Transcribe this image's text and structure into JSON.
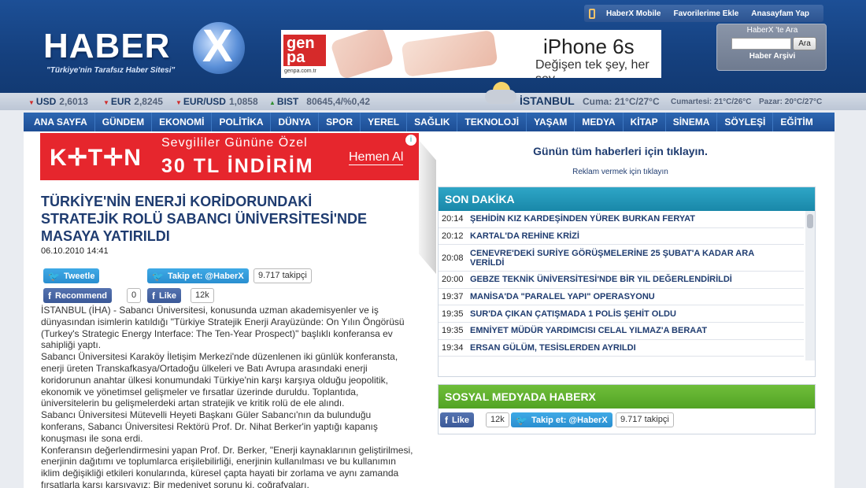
{
  "header": {
    "logo": "HABER",
    "logo_x": "X",
    "slogan": "\"Türkiye'nin Tarafsız Haber Sitesi\"",
    "ad": {
      "brand": "gen pa",
      "url": "genpa.com.tr",
      "title": "iPhone 6s",
      "subtitle": "Değişen tek şey, her şey."
    },
    "top_links": [
      "HaberX Mobile",
      "Favorilerime Ekle",
      "Anasayfam Yap"
    ],
    "search": {
      "title": "HaberX 'te Ara",
      "button": "Ara",
      "archive": "Haber Arşivi",
      "placeholder": ""
    }
  },
  "ticker": {
    "usd_label": "USD",
    "usd_value": "2,6013",
    "eur_label": "EUR",
    "eur_value": "2,8245",
    "eurusd_label": "EUR/USD",
    "eurusd_value": "1,0858",
    "bist_label": "BIST",
    "bist_value": "80645,4/%0,42",
    "city": "İSTANBUL",
    "today": "Cuma: 21°C/27°C",
    "saturday": "Cumartesi: 21°C/26°C",
    "sunday": "Pazar: 20°C/27°C"
  },
  "nav": [
    "ANA SAYFA",
    "GÜNDEM",
    "EKONOMİ",
    "POLİTİKA",
    "DÜNYA",
    "SPOR",
    "YEREL",
    "SAĞLIK",
    "TEKNOLOJİ",
    "YAŞAM",
    "MEDYA",
    "KİTAP",
    "SİNEMA",
    "SÖYLEŞİ",
    "EĞİTİM"
  ],
  "koton_ad": {
    "logo": "K✛T✛N",
    "line1": "Sevgililer Gününe Özel",
    "line2": "30 TL İNDİRİM",
    "cta": "Hemen Al"
  },
  "article": {
    "headline": "TÜRKİYE'NİN ENERJİ KORİDORUNDAKİ STRATEJİK ROLÜ SABANCI ÜNİVERSİTESİ'NDE MASAYA YATIRILDI",
    "date": "06.10.2010 14:41",
    "tweet_label": "Tweetle",
    "follow_label": "Takip et: @HaberX",
    "follow_count": "9.717 takipçi",
    "recommend_label": "Recommend",
    "recommend_count": "0",
    "like_label": "Like",
    "like_count": "12k",
    "paragraphs": [
      "İSTANBUL (İHA) - Sabancı Üniversitesi, konusunda uzman akademisyenler ve iş dünyasından isimlerin katıldığı \"Türkiye Stratejik Enerji Arayüzünde: On Yılın Öngörüsü (Turkey's Strategic Energy Interface: The Ten-Year Prospect)\" başlıklı konferansa ev sahipliği yaptı.",
      "Sabancı Üniversitesi Karaköy İletişim Merkezi'nde düzenlenen iki günlük konferansta, enerji üreten Transkafkasya/Ortadoğu ülkeleri ve Batı Avrupa arasındaki enerji koridorunun anahtar ülkesi konumundaki Türkiye'nin karşı karşıya olduğu jeopolitik, ekonomik ve yönetimsel gelişmeler ve fırsatlar üzerinde duruldu. Toplantıda, üniversitelerin bu gelişmelerdeki artan stratejik ve kritik rolü de ele alındı.",
      "Sabancı Üniversitesi Mütevelli Heyeti Başkanı Güler Sabancı'nın da bulunduğu konferans, Sabancı Üniversitesi Rektörü Prof. Dr. Nihat Berker'in yaptığı kapanış konuşması ile sona erdi.",
      "Konferansın değerlendirmesini yapan Prof. Dr. Berker, \"Enerji kaynaklarının geliştirilmesi, enerjinin dağıtımı ve toplumlarca erişilebilirliği, enerjinin kullanılması ve bu kullanımın iklim değişikliği etkileri konularında, küresel çapta hayati bir zorlama ve aynı zamanda fırsatlarla karşı karşıyayız: Bir medeniyet sorunu ki, coğrafyaları,"
    ]
  },
  "sidebar": {
    "all_news": "Günün tüm haberleri için tıklayın.",
    "ad_link": "Reklam vermek için tıklayın",
    "son_dakika_title": "SON DAKİKA",
    "news": [
      {
        "time": "20:14",
        "title": "ŞEHİDİN KIZ KARDEŞİNDEN YÜREK BURKAN FERYAT"
      },
      {
        "time": "20:12",
        "title": "KARTAL'DA REHİNE KRİZİ"
      },
      {
        "time": "20:08",
        "title": "CENEVRE'DEKİ SURİYE GÖRÜŞMELERİNE 25 ŞUBAT'A KADAR ARA VERİLDİ"
      },
      {
        "time": "20:00",
        "title": "GEBZE TEKNİK ÜNİVERSİTESİ'NDE BİR YIL DEĞERLENDİRİLDİ"
      },
      {
        "time": "19:37",
        "title": "MANİSA'DA \"PARALEL YAPI\" OPERASYONU"
      },
      {
        "time": "19:35",
        "title": "SUR'DA ÇIKAN ÇATIŞMADA 1 POLİS ŞEHİT OLDU"
      },
      {
        "time": "19:35",
        "title": "EMNİYET MÜDÜR YARDIMCISI CELAL YILMAZ'A BERAAT"
      },
      {
        "time": "19:34",
        "title": "ERSAN GÜLÜM, TESİSLERDEN AYRILDI"
      }
    ],
    "social_title": "SOSYAL MEDYADA HABERX",
    "social_like_label": "Like",
    "social_like_count": "12k",
    "social_follow_label": "Takip et: @HaberX",
    "social_follow_count": "9.717 takipçi"
  }
}
